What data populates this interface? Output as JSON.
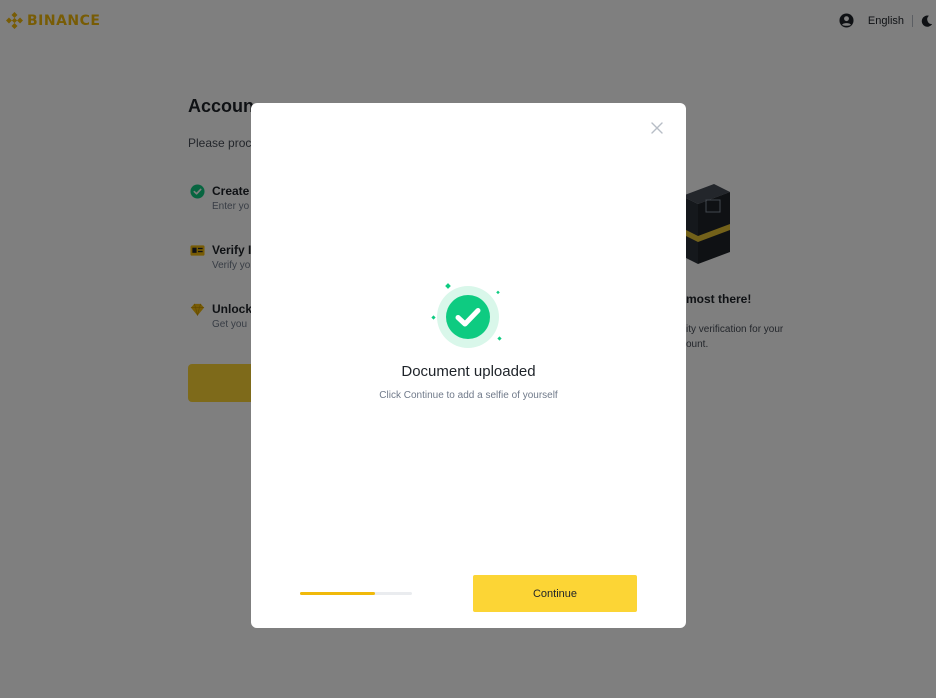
{
  "header": {
    "brand": "BINANCE",
    "language": "English",
    "brand_color": "#f0b90b"
  },
  "background": {
    "title": "Accoun",
    "subtitle": "Please proc",
    "steps": [
      {
        "title": "Create",
        "desc": "Enter yo",
        "icon": "check-circle-icon"
      },
      {
        "title": "Verify I",
        "desc": "Verify yo",
        "icon": "id-card-icon"
      },
      {
        "title": "Unlock",
        "desc": "Get you",
        "icon": "diamond-gift-icon"
      }
    ],
    "side_title": "most there!",
    "side_desc_line1": "ity verification for your",
    "side_desc_line2": "ount."
  },
  "modal": {
    "title": "Document uploaded",
    "subtitle": "Click Continue to add a selfie of yourself",
    "continue_label": "Continue",
    "progress": 0.67,
    "accent_color": "#fcd535",
    "success_color": "#0ecb81"
  }
}
